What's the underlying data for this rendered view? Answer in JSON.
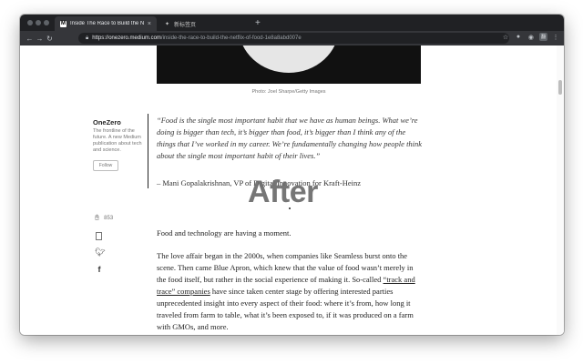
{
  "browser": {
    "tabs": [
      {
        "label": "Inside The Race to Build the N",
        "favicon": "medium-icon",
        "close": "×"
      },
      {
        "label": "新标签页",
        "favicon": "puzzle-icon"
      }
    ],
    "new_tab": "+",
    "url_host": "https://onezero.medium.com",
    "url_path": "/inside-the-race-to-build-the-netflix-of-food-1e8a8abd007e",
    "extension_badge": "翻"
  },
  "article": {
    "image_caption": "Photo: Joel Sharpe/Getty Images",
    "publication": {
      "name": "OneZero",
      "description": "The frontline of the future. A new Medium publication about tech and science.",
      "follow_label": "Follow"
    },
    "quote": "“Food is the single most important habit that we have as human beings. What we’re doing is bigger than tech, it’s bigger than food, it’s bigger than I think any of the things that I’ve worked in my career. We’re fundamentally changing how people think about the single most important habit of their lives.”",
    "attribution": "– Mani Gopalakrishnan, VP of Digital Innovation for Kraft-Heinz",
    "overlay_text": "After",
    "clap_count": "853",
    "paragraph1": "Food and technology are having a moment.",
    "paragraph2_before": "The love affair began in the 2000s, when companies like Seamless burst onto the scene. Then came Blue Apron, which knew that the value of food wasn’t merely in the food itself, but rather in the social experience of making it. So-called ",
    "paragraph2_link": "“track and trace” companies",
    "paragraph2_after": " have since taken center stage by offering interested parties unprecedented insight into every aspect of their food: where it’s from, how long it traveled from farm to table, what it’s been exposed to, if it was produced on a farm with GMOs, and more."
  }
}
